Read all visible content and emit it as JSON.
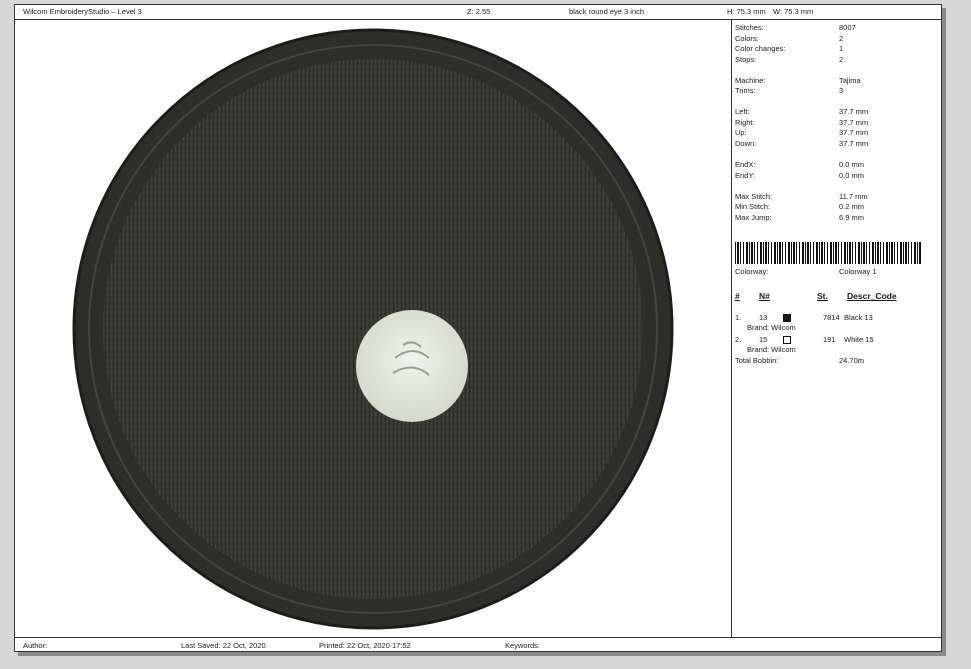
{
  "header": {
    "app_title": "Wilcom EmbroideryStudio – Level 3",
    "zoom": "Z: 2.55",
    "design_name": "black round eye 3 inch",
    "height": "H: 75.3 mm",
    "width": "W: 75.3 mm"
  },
  "stats": [
    {
      "label": "Stitches:",
      "value": "8007"
    },
    {
      "label": "Colors:",
      "value": "2"
    },
    {
      "label": "Color changes:",
      "value": "1"
    },
    {
      "label": "Stops:",
      "value": "2"
    },
    {
      "label": "Machine:",
      "value": "Tajima"
    },
    {
      "label": "Trims:",
      "value": "3"
    },
    {
      "label": "Left:",
      "value": "37.7 mm"
    },
    {
      "label": "Right:",
      "value": "37.7 mm"
    },
    {
      "label": "Up:",
      "value": "37.7 mm"
    },
    {
      "label": "Down:",
      "value": "37.7 mm"
    },
    {
      "label": "EndX:",
      "value": "0.0 mm"
    },
    {
      "label": "EndY:",
      "value": "0.0 mm"
    },
    {
      "label": "Max Stitch:",
      "value": "11.7 mm"
    },
    {
      "label": "Min Stitch:",
      "value": "0.2 mm"
    },
    {
      "label": "Max Jump:",
      "value": "6.9 mm"
    }
  ],
  "colorway": {
    "label": "Colorway:",
    "value": "Colorway 1"
  },
  "table_headers": {
    "num": "#",
    "n": "N#",
    "st": "St.",
    "descr": "Descr_Code"
  },
  "threads": [
    {
      "idx": "1.",
      "n": "13",
      "swatch": "#1a1a1a",
      "st": "7814",
      "descr": "Black 13",
      "brand": "Brand: Wilcom"
    },
    {
      "idx": "2.",
      "n": "15",
      "swatch": "#ffffff",
      "st": "191",
      "descr": "White 15",
      "brand": "Brand: Wilcom"
    }
  ],
  "bobbin": {
    "label": "Total Bobbin:",
    "value": "24.70m"
  },
  "footer": {
    "author": "Author:",
    "last_saved": "Last Saved: 22 Oct, 2020",
    "printed": "Printed: 22 Oct, 2020 17:52",
    "keywords": "Keywords:"
  },
  "colors": {
    "fill": "#3a3b35",
    "border": "#2d2e29",
    "eye": "#e4e8dc"
  }
}
